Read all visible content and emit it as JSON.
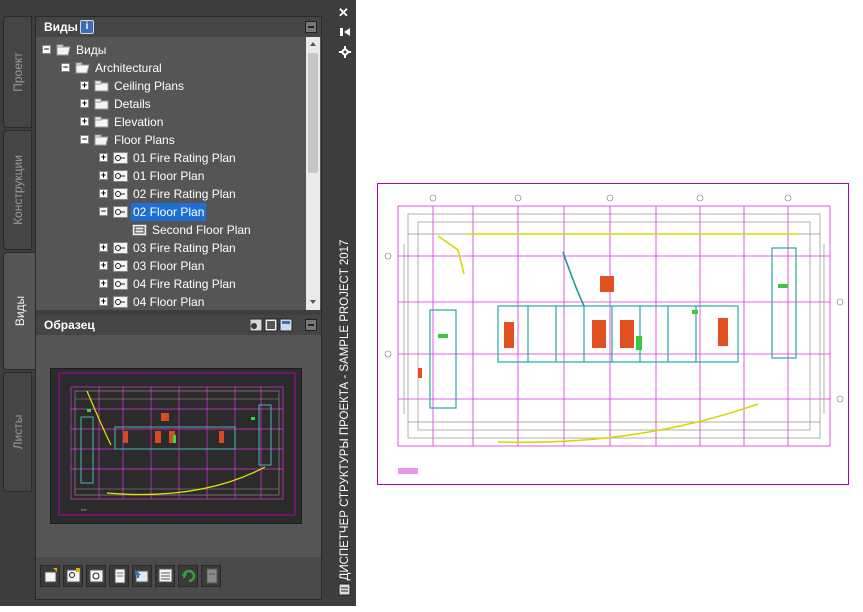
{
  "palette": {
    "title": "ДИСПЕТЧЕР СТРУКТУРЫ ПРОЕКТА - SAMPLE PROJECT 2017",
    "close_glyph": "✕",
    "side_tabs": [
      {
        "label": "Проект"
      },
      {
        "label": "Конструкции"
      },
      {
        "label": "Виды"
      },
      {
        "label": "Листы"
      }
    ]
  },
  "views_panel": {
    "title": "Виды",
    "info_icon": "info-icon",
    "tree": [
      {
        "label": "Виды",
        "level": 0,
        "expander": "−",
        "icon": "folder-open-icon"
      },
      {
        "label": "Architectural",
        "level": 1,
        "expander": "−",
        "icon": "folder-open-icon"
      },
      {
        "label": "Ceiling Plans",
        "level": 2,
        "expander": "+",
        "icon": "folder-icon"
      },
      {
        "label": "Details",
        "level": 2,
        "expander": "+",
        "icon": "folder-icon"
      },
      {
        "label": "Elevation",
        "level": 2,
        "expander": "+",
        "icon": "folder-icon"
      },
      {
        "label": "Floor Plans",
        "level": 2,
        "expander": "−",
        "icon": "folder-open-icon"
      },
      {
        "label": "01 Fire Rating Plan",
        "level": 3,
        "expander": "+",
        "icon": "view-key-icon"
      },
      {
        "label": "01 Floor Plan",
        "level": 3,
        "expander": "+",
        "icon": "view-key-icon"
      },
      {
        "label": "02 Fire Rating Plan",
        "level": 3,
        "expander": "+",
        "icon": "view-key-icon"
      },
      {
        "label": "02 Floor Plan",
        "level": 3,
        "expander": "−",
        "icon": "view-key-icon",
        "selected": true
      },
      {
        "label": "Second Floor Plan",
        "level": 4,
        "expander": "",
        "icon": "model-view-icon"
      },
      {
        "label": "03 Fire Rating Plan",
        "level": 3,
        "expander": "+",
        "icon": "view-key-icon"
      },
      {
        "label": "03 Floor Plan",
        "level": 3,
        "expander": "+",
        "icon": "view-key-icon"
      },
      {
        "label": "04 Fire Rating Plan",
        "level": 3,
        "expander": "+",
        "icon": "view-key-icon"
      },
      {
        "label": "04 Floor Plan",
        "level": 3,
        "expander": "+",
        "icon": "view-key-icon"
      }
    ]
  },
  "preview_panel": {
    "title": "Образец"
  },
  "bottom_toolbar": {
    "buttons": [
      "new-view-icon",
      "add-view-icon",
      "regenerate-icon",
      "sheet-icon",
      "open-icon",
      "properties-icon",
      "refresh-icon",
      "close-file-icon"
    ]
  }
}
